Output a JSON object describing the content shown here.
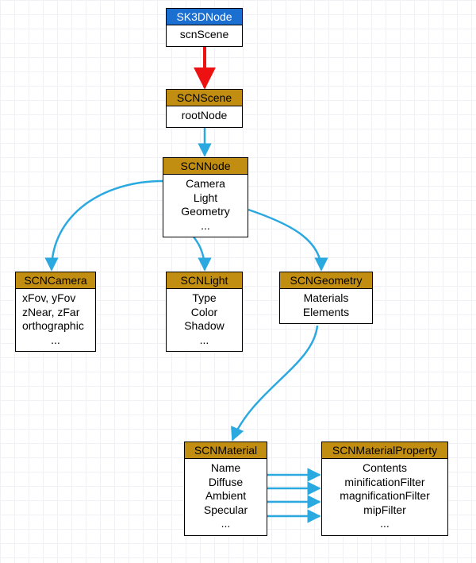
{
  "nodes": {
    "sk3d": {
      "title": "SK3DNode",
      "items": [
        "scnScene"
      ]
    },
    "scnscene": {
      "title": "SCNScene",
      "items": [
        "rootNode"
      ]
    },
    "scnnode": {
      "title": "SCNNode",
      "items": [
        "Camera",
        "Light",
        "Geometry",
        "..."
      ]
    },
    "scncamera": {
      "title": "SCNCamera",
      "items": [
        "xFov, yFov",
        "zNear, zFar",
        "orthographic",
        "..."
      ]
    },
    "scnlight": {
      "title": "SCNLight",
      "items": [
        "Type",
        "Color",
        "Shadow",
        "..."
      ]
    },
    "scngeometry": {
      "title": "SCNGeometry",
      "items": [
        "Materials",
        "Elements"
      ]
    },
    "scnmaterial": {
      "title": "SCNMaterial",
      "items": [
        "Name",
        "Diffuse",
        "Ambient",
        "Specular",
        "..."
      ]
    },
    "scnmaterialproperty": {
      "title": "SCNMaterialProperty",
      "items": [
        "Contents",
        "minificationFilter",
        "magnificationFilter",
        "mipFilter",
        "..."
      ]
    }
  }
}
